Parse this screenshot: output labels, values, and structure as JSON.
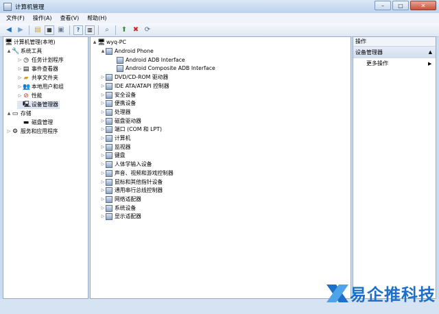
{
  "window": {
    "title": "计算机管理",
    "min_label": "–",
    "max_label": "□",
    "close_label": "✕"
  },
  "menu": [
    "文件(F)",
    "操作(A)",
    "查看(V)",
    "帮助(H)"
  ],
  "left_tree": [
    {
      "label": "计算机管理(本地)",
      "icon": "computer-management-icon",
      "arrow": ""
    },
    {
      "label": "系统工具",
      "icon": "tools-icon",
      "arrow": "▲"
    },
    {
      "label": "任务计划程序",
      "icon": "clock-icon",
      "arrow": "▷"
    },
    {
      "label": "事件查看器",
      "icon": "event-viewer-icon",
      "arrow": "▷"
    },
    {
      "label": "共享文件夹",
      "icon": "shared-folder-icon",
      "arrow": "▷"
    },
    {
      "label": "本地用户和组",
      "icon": "users-icon",
      "arrow": "▷"
    },
    {
      "label": "性能",
      "icon": "performance-icon",
      "arrow": "▷"
    },
    {
      "label": "设备管理器",
      "icon": "device-manager-icon",
      "arrow": ""
    },
    {
      "label": "存储",
      "icon": "storage-icon",
      "arrow": "▲"
    },
    {
      "label": "磁盘管理",
      "icon": "disk-management-icon",
      "arrow": ""
    },
    {
      "label": "服务和应用程序",
      "icon": "services-icon",
      "arrow": "▷"
    }
  ],
  "device_tree": {
    "root": "wyq-PC",
    "items": [
      {
        "label": "Android Phone",
        "arrow": "▲",
        "level": 1
      },
      {
        "label": "Android ADB Interface",
        "arrow": "",
        "level": 2
      },
      {
        "label": "Android Composite ADB Interface",
        "arrow": "",
        "level": 2
      },
      {
        "label": "DVD/CD-ROM 驱动器",
        "arrow": "▷",
        "level": 1
      },
      {
        "label": "IDE ATA/ATAPI 控制器",
        "arrow": "▷",
        "level": 1
      },
      {
        "label": "安全设备",
        "arrow": "▷",
        "level": 1
      },
      {
        "label": "便携设备",
        "arrow": "▷",
        "level": 1
      },
      {
        "label": "处理器",
        "arrow": "▷",
        "level": 1
      },
      {
        "label": "磁盘驱动器",
        "arrow": "▷",
        "level": 1
      },
      {
        "label": "端口 (COM 和 LPT)",
        "arrow": "▷",
        "level": 1
      },
      {
        "label": "计算机",
        "arrow": "▷",
        "level": 1
      },
      {
        "label": "监视器",
        "arrow": "▷",
        "level": 1
      },
      {
        "label": "键盘",
        "arrow": "▷",
        "level": 1
      },
      {
        "label": "人体学输入设备",
        "arrow": "▷",
        "level": 1
      },
      {
        "label": "声音、视频和游戏控制器",
        "arrow": "▷",
        "level": 1
      },
      {
        "label": "鼠标和其他指针设备",
        "arrow": "▷",
        "level": 1
      },
      {
        "label": "通用串行总线控制器",
        "arrow": "▷",
        "level": 1
      },
      {
        "label": "网络适配器",
        "arrow": "▷",
        "level": 1
      },
      {
        "label": "系统设备",
        "arrow": "▷",
        "level": 1
      },
      {
        "label": "显示适配器",
        "arrow": "▷",
        "level": 1
      }
    ]
  },
  "actions": {
    "header": "操作",
    "section": "设备管理器",
    "more": "更多操作"
  },
  "watermark": {
    "text": "易企推科技"
  }
}
